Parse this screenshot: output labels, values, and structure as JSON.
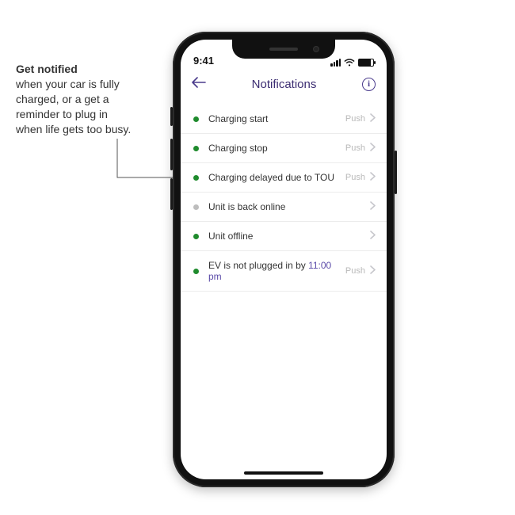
{
  "callout": {
    "lead": "Get notified",
    "body": "when your car is fully charged, or a get a reminder to plug in when life gets too busy."
  },
  "status": {
    "time": "9:41"
  },
  "nav": {
    "title": "Notifications",
    "info_glyph": "i"
  },
  "push_label": "Push",
  "items": [
    {
      "dot": "green",
      "label": "Charging start",
      "time": "",
      "push": true
    },
    {
      "dot": "green",
      "label": "Charging stop",
      "time": "",
      "push": true
    },
    {
      "dot": "green",
      "label": "Charging delayed due to TOU",
      "time": "",
      "push": true
    },
    {
      "dot": "grey",
      "label": "Unit is back online",
      "time": "",
      "push": false
    },
    {
      "dot": "green",
      "label": "Unit offline",
      "time": "",
      "push": false
    },
    {
      "dot": "green",
      "label": "EV is not plugged in by ",
      "time": "11:00 pm",
      "push": true
    }
  ]
}
